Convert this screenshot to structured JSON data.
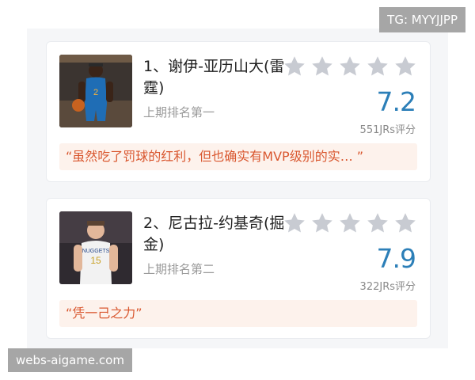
{
  "watermarks": {
    "top_right": "TG: MYYJJPP",
    "bottom_left": "webs-aigame.com"
  },
  "players": [
    {
      "name": "1、谢伊-亚历山大(雷霆)",
      "rank_text": "上期排名第一",
      "score": "7.2",
      "votes": "551JRs评分",
      "comment": "“虽然吃了罚球的红利，但也确实有MVP级别的实…  ”",
      "jersey": "2",
      "jersey_color": "#1f6db5"
    },
    {
      "name": "2、尼古拉-约基奇(掘金)",
      "rank_text": "上期排名第二",
      "score": "7.9",
      "votes": "322JRs评分",
      "comment": "“凭一己之力”",
      "jersey": "15",
      "jersey_color": "#f2f2f2"
    }
  ],
  "colors": {
    "score": "#2c7fb8",
    "comment_text": "#d9572f",
    "comment_bg": "#fdf2ec",
    "star_empty": "#c8cbd2"
  },
  "icons": {
    "star": "star-outline-icon"
  }
}
